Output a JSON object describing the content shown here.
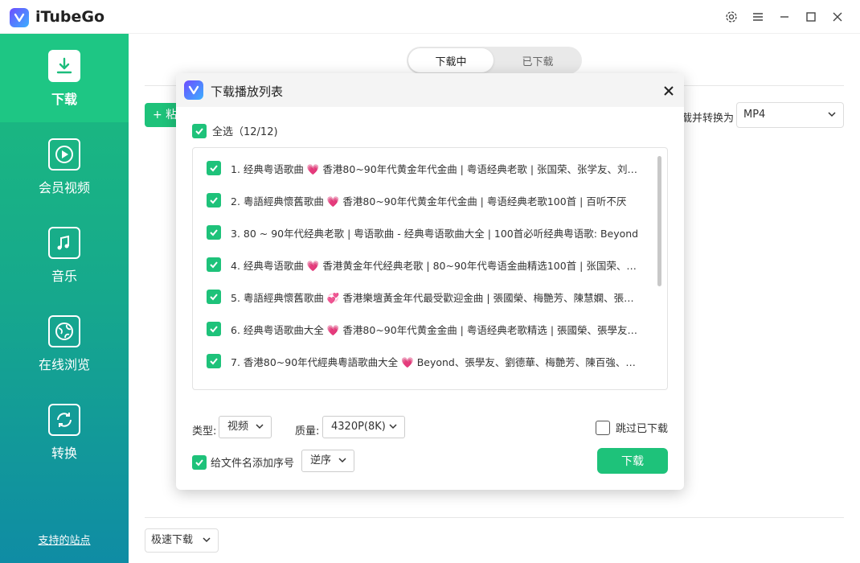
{
  "app": {
    "title": "iTubeGo"
  },
  "sidebar": {
    "items": [
      {
        "label": "下载",
        "icon": "download-icon"
      },
      {
        "label": "会员视频",
        "icon": "play-icon"
      },
      {
        "label": "音乐",
        "icon": "music-icon"
      },
      {
        "label": "在线浏览",
        "icon": "globe-icon"
      },
      {
        "label": "转换",
        "icon": "convert-icon"
      }
    ],
    "support_link": "支持的站点"
  },
  "main": {
    "tabs": [
      {
        "label": "下载中"
      },
      {
        "label": "已下载"
      }
    ],
    "paste_button_label": "+ 粘",
    "convert_label": "载并转换为",
    "format_value": "MP4",
    "speed_value": "极速下载"
  },
  "modal": {
    "title": "下载播放列表",
    "select_all_label": "全选（12/12)",
    "items": [
      "1. 经典粤语歌曲 💗 香港80~90年代黄金年代金曲 | 粤语经典老歌 | 张国荣、张学友、刘德华、梅艳芳",
      "2. 粵語經典懷舊歌曲 💗 香港80~90年代黄金年代金曲 | 粤语经典老歌100首 | 百听不厌",
      "3. 80 ~ 90年代经典老歌 | 粤语歌曲 - 经典粤语歌曲大全 | 100首必听经典粤语歌: Beyond",
      "4. 经典粤语歌曲 💗 香港黄金年代经典老歌 | 80~90年代粤语金曲精选100首 | 张国荣、梅艳芳",
      "5. 粵語經典懷舊歌曲 💞 香港樂壇黃金年代最受歡迎金曲 | 張國榮、梅艷芳、陳慧嫻、張學友",
      "6. 经典粤语歌曲大全 💗 香港80~90年代黄金金曲 | 粤语经典老歌精选 | 張國榮、張學友、劉德華",
      "7. 香港80~90年代經典粵語歌曲大全 💗 Beyond、張學友、劉德華、梅艷芳、陳百強、譚詠麟"
    ],
    "type_label": "类型:",
    "type_value": "视频",
    "quality_label": "质量:",
    "quality_value": "4320P(8K)",
    "skip_label": "跳过已下载",
    "numbering_label": "给文件名添加序号",
    "order_value": "逆序",
    "download_button": "下载"
  },
  "colors": {
    "accent": "#1ec27a",
    "sidebar_top": "#1cbd7c",
    "sidebar_bottom": "#0f8ca4"
  }
}
